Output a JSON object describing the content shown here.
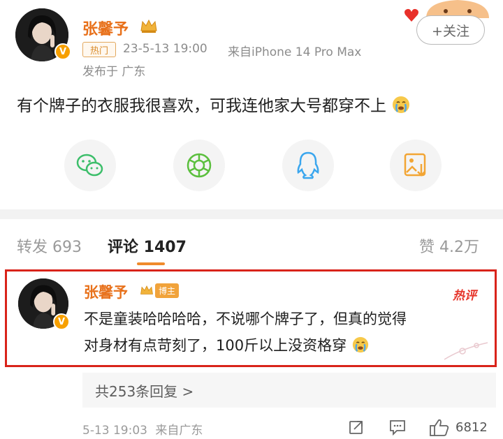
{
  "post": {
    "username": "张馨予",
    "hot_tag": "热门",
    "datetime": "23-5-13 19:00",
    "source": "来自iPhone 14 Pro Max",
    "location": "发布于 广东",
    "follow_label": "+关注",
    "text": "有个牌子的衣服我很喜欢，可我连他家大号都穿不上",
    "emoji": "cry-emoji",
    "vip_badge": "V"
  },
  "share": {
    "icons": [
      "wechat-icon",
      "moments-icon",
      "qq-icon",
      "save-image-icon"
    ]
  },
  "tabs": {
    "repost": "转发 693",
    "comment": "评论 1407",
    "like": "赞 4.2万"
  },
  "comment": {
    "username": "张馨予",
    "blogger_tag": "博主",
    "hot_label": "热评",
    "line1": "不是童装哈哈哈哈，不说哪个牌子了，但真的觉得",
    "line2": "对身材有点苛刻了，100斤以上没资格穿",
    "emoji": "cry-emoji",
    "vip_badge": "V",
    "replies": "共253条回复 >",
    "datetime": "5-13 19:03",
    "source": "来自广东",
    "likes": "6812"
  },
  "colors": {
    "accent": "#e8711b",
    "highlight_border": "#d9231a",
    "hot_red": "#e6362c"
  }
}
